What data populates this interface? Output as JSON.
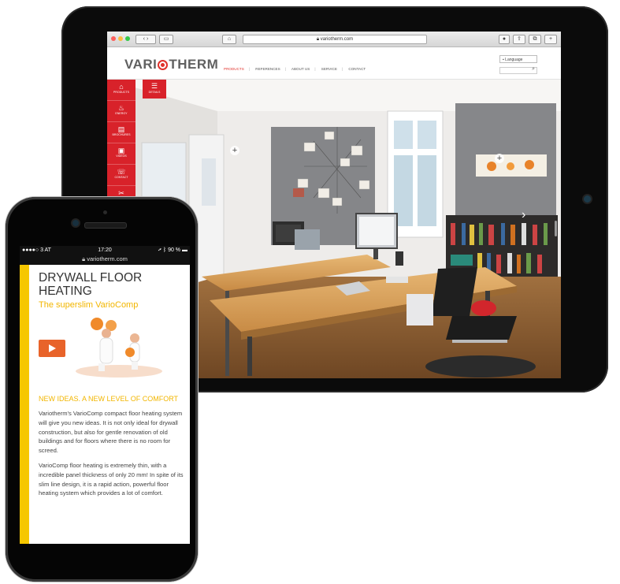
{
  "tablet": {
    "browser": {
      "url": "variotherm.com",
      "back_icon": "chevron-left-icon",
      "forward_icon": "chevron-right-icon",
      "home_icon": "home-icon",
      "reload_icon": "reload-icon"
    },
    "site": {
      "logo": "VARIOTHERM",
      "nav": [
        "PRODUCTS",
        "REFERENCES",
        "ABOUT US",
        "SERVICE",
        "CONTACT"
      ],
      "language_label": "Language",
      "side_menu": [
        {
          "label": "PRODUCTS",
          "icon": "house-icon"
        },
        {
          "label": "ENERGY",
          "icon": "bulb-icon"
        },
        {
          "label": "BROCHURES",
          "icon": "brochure-icon"
        },
        {
          "label": "VIDEOS",
          "icon": "video-icon"
        },
        {
          "label": "CONTACT",
          "icon": "phone-icon"
        },
        {
          "label": "TRAINING",
          "icon": "tools-icon"
        }
      ],
      "details_label": "DETAILS"
    }
  },
  "phone": {
    "status": {
      "carrier": "●●●●○ 3 AT",
      "time": "17:20",
      "battery": "90 %"
    },
    "url": "variotherm.com",
    "title": "DRYWALL FLOOR HEATING",
    "subtitle": "The superslim VarioComp",
    "section_heading": "NEW IDEAS. A NEW LEVEL OF COMFORT",
    "paragraphs": [
      "Variotherm's VarioComp compact floor heating system will give you new ideas. It is not only ideal for drywall construction, but also for gentle renovation of old buildings and for floors where there is no room for screed.",
      "VarioComp floor heating is extremely thin, with a incredible panel thickness of only 20 mm! In spite of its slim line design, it is a rapid action, powerful floor heating system which provides a lot of comfort."
    ]
  },
  "colors": {
    "brand_red": "#d8222a",
    "accent_yellow": "#f6c700",
    "play_orange": "#e8632a"
  }
}
